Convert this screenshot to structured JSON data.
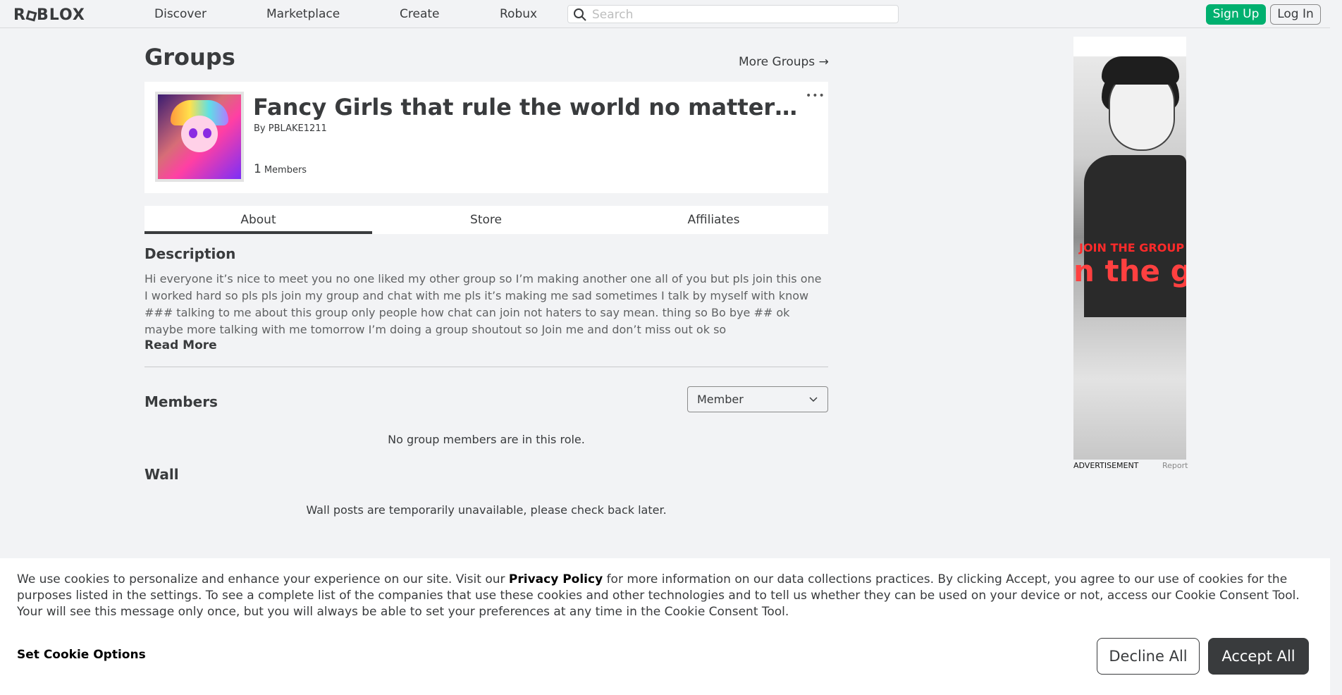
{
  "nav": {
    "logo": "ROBLOX",
    "links": [
      "Discover",
      "Marketplace",
      "Create",
      "Robux"
    ],
    "search_placeholder": "Search",
    "sign_up": "Sign Up",
    "log_in": "Log In"
  },
  "header": {
    "title": "Groups",
    "more_groups": "More Groups →"
  },
  "group": {
    "name": "Fancy Girls that rule the world no matter what",
    "by_prefix": "By",
    "owner": "PBLAKE1211",
    "member_count": "1",
    "members_label": "Members",
    "menu_icon": "ellipsis-icon"
  },
  "tabs": [
    "About",
    "Store",
    "Affiliates"
  ],
  "about": {
    "description_heading": "Description",
    "description": "Hi everyone it’s nice to meet you no one liked my other group so I’m making another one all of you but pls join this one I worked hard so pls pls join my group and chat with me pls it’s making me sad sometimes I talk by myself with know ### talking to me about this group only people how chat can join not haters to say mean. thing so Bo bye ## ok maybe more talking with me tomorrow I’m doing a group shoutout so Join me and don’t miss out ok so",
    "read_more": "Read More",
    "members_heading": "Members",
    "role_selected": "Member",
    "no_members": "No group members are in this role.",
    "wall_heading": "Wall",
    "wall_message": "Wall posts are temporarily unavailable, please check back later."
  },
  "ad": {
    "overlay_small": "JOIN THE GROUP",
    "overlay_large": "n the gro",
    "label": "ADVERTISEMENT",
    "report": "Report"
  },
  "cookie": {
    "text_before": "We use cookies to personalize and enhance your experience on our site. Visit our ",
    "privacy_link": "Privacy Policy",
    "text_after": " for more information on our data collections practices. By clicking Accept, you agree to our use of cookies for the purposes listed in the settings. To see a complete list of the companies that use these cookies and other technologies and to tell us whether they can be used on your device or not, access our Cookie Consent Tool. Your will see this message only once, but you will always be able to set your preferences at any time in the Cookie Consent Tool.",
    "set_options": "Set Cookie Options",
    "decline": "Decline All",
    "accept": "Accept All"
  },
  "colors": {
    "signup_green": "#00b06f",
    "text_dark": "#393b3d",
    "background": "#f2f3f5"
  }
}
